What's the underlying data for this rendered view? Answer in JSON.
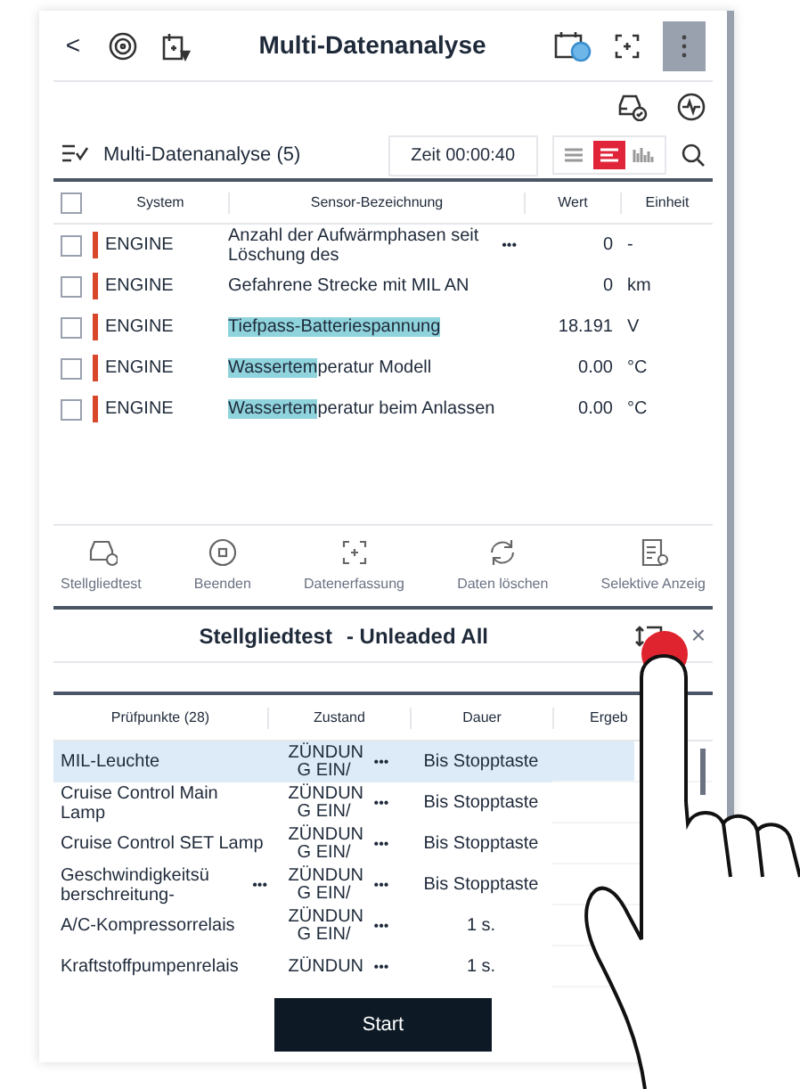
{
  "header": {
    "title": "Multi-Datenanalyse",
    "back": "<"
  },
  "toolbar": {
    "title": "Multi-Datenanalyse (5)",
    "time": "Zeit 00:00:40",
    "view_modes": [
      {
        "kind": "list",
        "selected": false
      },
      {
        "kind": "bars",
        "selected": true
      },
      {
        "kind": "wave",
        "selected": false
      }
    ]
  },
  "sensor_table": {
    "all_checked": false,
    "columns": [
      "System",
      "Sensor-Bezeichnung",
      "Wert",
      "Einheit"
    ],
    "rows": [
      {
        "checked": false,
        "system": "ENGINE",
        "color": "#d9472b",
        "name": "Anzahl der Aufwärmphasen seit Löschung des",
        "more": "•••",
        "value": "0",
        "unit": "-"
      },
      {
        "checked": false,
        "system": "ENGINE",
        "color": "#d9472b",
        "name": "Gefahrene Strecke mit MIL AN",
        "value": "0",
        "unit": "km"
      },
      {
        "checked": false,
        "system": "ENGINE",
        "color": "#d9472b",
        "name_highlighted": "Tiefpass-Batteriespannung",
        "value": "18.191",
        "unit": "V"
      },
      {
        "checked": false,
        "system": "ENGINE",
        "color": "#d9472b",
        "name_highlighted": "Wassertem",
        "name": "peratur Modell",
        "value": "0.00",
        "unit": "°C"
      },
      {
        "checked": false,
        "system": "ENGINE",
        "color": "#d9472b",
        "name_highlighted": "Wassertem",
        "name": "peratur beim Anlassen",
        "value": "0.00",
        "unit": "°C"
      }
    ]
  },
  "actions": [
    {
      "kind": "actuator",
      "label": "Stellgliedtest"
    },
    {
      "kind": "stop",
      "label": "Beenden"
    },
    {
      "kind": "capture",
      "label": "Datenerfassung"
    },
    {
      "kind": "refresh",
      "label": "Daten löschen"
    },
    {
      "kind": "select",
      "label": "Selektive Anzeig"
    }
  ],
  "panel": {
    "title": "Stellgliedtest",
    "subtitle": "- Unleaded All",
    "close": "×",
    "columns": [
      "Prüfpunkte (28)",
      "Zustand",
      "Dauer",
      "Ergeb"
    ],
    "rows": [
      {
        "selected": true,
        "item": "MIL-Leuchte",
        "state": "ZÜNDUN G EIN/",
        "state_more": "•••",
        "duration": "Bis Stopptaste"
      },
      {
        "selected": false,
        "item": "Cruise Control Main Lamp",
        "state": "ZÜNDUN G EIN/",
        "state_more": "•••",
        "duration": "Bis Stopptaste"
      },
      {
        "selected": false,
        "item": "Cruise Control SET Lamp",
        "state": "ZÜNDUN G EIN/",
        "state_more": "•••",
        "duration": "Bis Stopptaste"
      },
      {
        "selected": false,
        "item": "Geschwindigkeitsü berschreitung-",
        "item_more": "•••",
        "state": "ZÜNDUN G EIN/",
        "state_more": "•••",
        "duration": "Bis Stopptaste"
      },
      {
        "selected": false,
        "item": "A/C-Kompressorrelais",
        "state": "ZÜNDUN G EIN/",
        "state_more": "•••",
        "duration": "1 s."
      },
      {
        "selected": false,
        "item": "Kraftstoffpumpenrelais",
        "state": "ZÜNDUN",
        "state_more": "•••",
        "duration": "1 s."
      }
    ],
    "start": "Start"
  }
}
